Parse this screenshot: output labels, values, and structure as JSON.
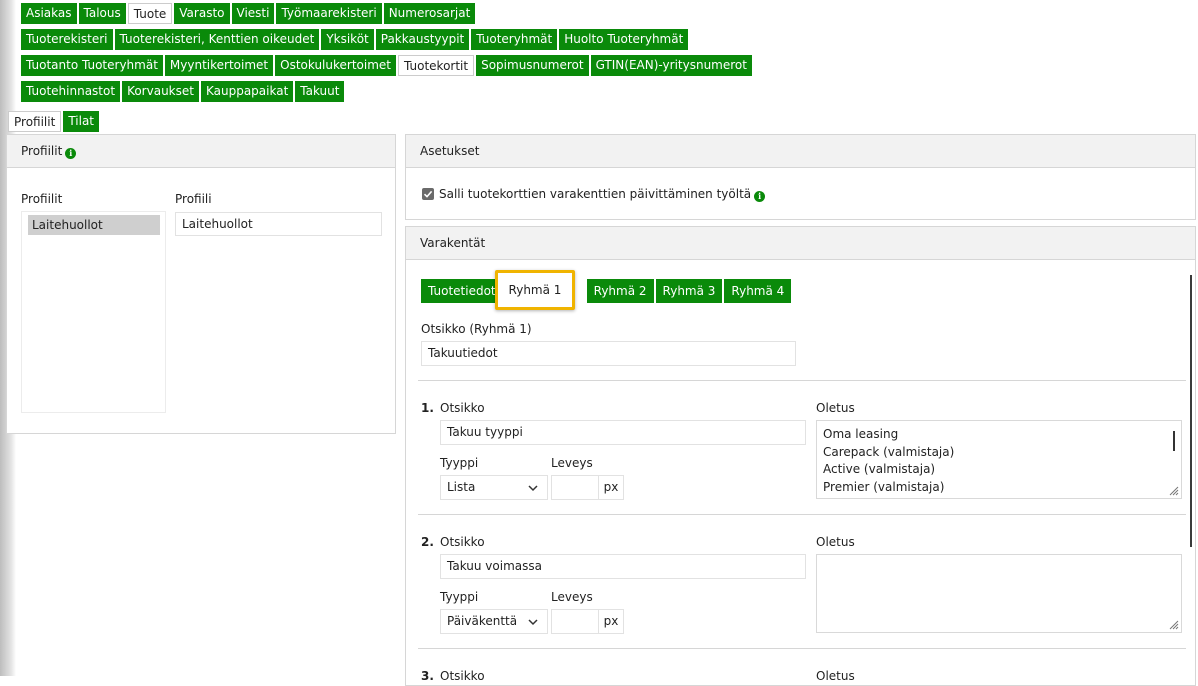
{
  "top_tabs": {
    "row1": [
      "Asiakas",
      "Talous",
      "Tuote",
      "Varasto",
      "Viesti",
      "Työmaarekisteri",
      "Numerosarjat"
    ],
    "row2": [
      "Tuoterekisteri",
      "Tuoterekisteri, Kenttien oikeudet",
      "Yksiköt",
      "Pakkaustyypit",
      "Tuoteryhmät",
      "Huolto Tuoteryhmät"
    ],
    "row3": [
      "Tuotanto Tuoteryhmät",
      "Myyntikertoimet",
      "Ostokulukertoimet",
      "Tuotekortit",
      "Sopimusnumerot",
      "GTIN(EAN)-yritysnumerot"
    ],
    "row4": [
      "Tuotehinnastot",
      "Korvaukset",
      "Kauppapaikat",
      "Takuut"
    ],
    "selected_row1": "Tuote",
    "selected_row3": "Tuotekortit"
  },
  "sub_tabs": {
    "items": [
      "Profiilit",
      "Tilat"
    ],
    "selected": "Profiilit"
  },
  "profiles_panel": {
    "title": "Profiilit",
    "list_label": "Profiilit",
    "list_items": [
      "Laitehuollot"
    ],
    "profile_label": "Profiili",
    "profile_value": "Laitehuollot"
  },
  "settings_panel": {
    "title": "Asetukset",
    "checkbox_label": "Salli tuotekorttien varakenttien päivittäminen työltä",
    "checkbox_checked": true
  },
  "spare_fields": {
    "title": "Varakentät",
    "tabs": [
      "Tuotetiedot",
      "Ryhmä 1",
      "Ryhmä 2",
      "Ryhmä 3",
      "Ryhmä 4"
    ],
    "selected_tab": "Ryhmä 1",
    "heading_label": "Otsikko (Ryhmä 1)",
    "heading_value": "Takuutiedot",
    "fields": [
      {
        "num": "1.",
        "title_label": "Otsikko",
        "title_value": "Takuu tyyppi",
        "type_label": "Tyyppi",
        "type_value": "Lista",
        "width_label": "Leveys",
        "width_value": "",
        "unit": "px",
        "default_label": "Oletus",
        "default_lines": [
          "Oma leasing",
          "Carepack  (valmistaja)",
          "Active (valmistaja)",
          "Premier  (valmistaja)"
        ]
      },
      {
        "num": "2.",
        "title_label": "Otsikko",
        "title_value": "Takuu voimassa",
        "type_label": "Tyyppi",
        "type_value": "Päiväkenttä",
        "width_label": "Leveys",
        "width_value": "",
        "unit": "px",
        "default_label": "Oletus",
        "default_lines": []
      },
      {
        "num": "3.",
        "title_label": "Otsikko",
        "default_label": "Oletus"
      }
    ]
  },
  "colors": {
    "accent": "#0a8a0a",
    "highlight": "#f0b400"
  }
}
